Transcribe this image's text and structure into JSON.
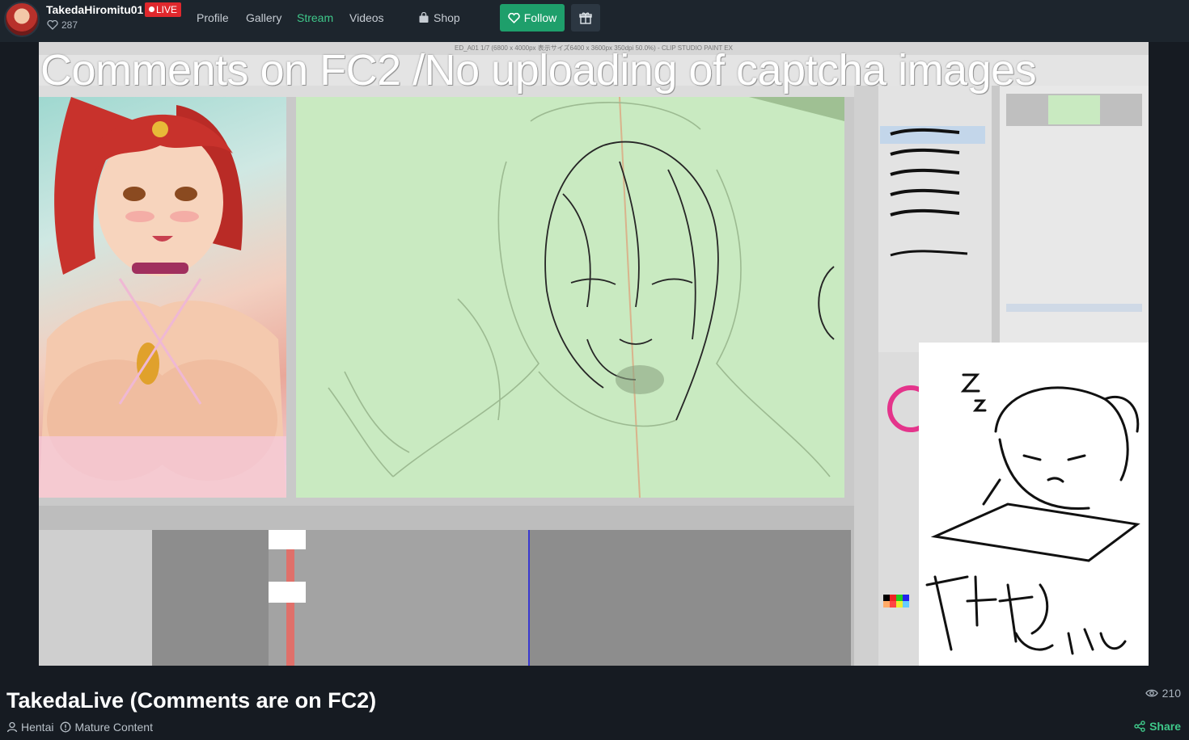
{
  "channel": {
    "name": "TakedaHiromitu01",
    "live_label": "LIVE",
    "likes": "287"
  },
  "nav": {
    "profile": "Profile",
    "gallery": "Gallery",
    "stream": "Stream",
    "videos": "Videos",
    "shop": "Shop"
  },
  "actions": {
    "follow": "Follow"
  },
  "video": {
    "overlay_text": "Comments on FC2 /No uploading of captcha images",
    "window_title": "ED_A01 1/7 (6800 x 4000px 表示サイズ6400 x 3600px 350dpi 50.0%) - CLIP STUDIO PAINT EX"
  },
  "stream": {
    "title": "TakedaLive (Comments are on FC2)",
    "views": "210",
    "tags": [
      "Hentai",
      "Mature Content"
    ],
    "share": "Share"
  },
  "colors": {
    "accent": "#3fc88a",
    "live": "#e0282d",
    "follow": "#1e9f6b"
  }
}
